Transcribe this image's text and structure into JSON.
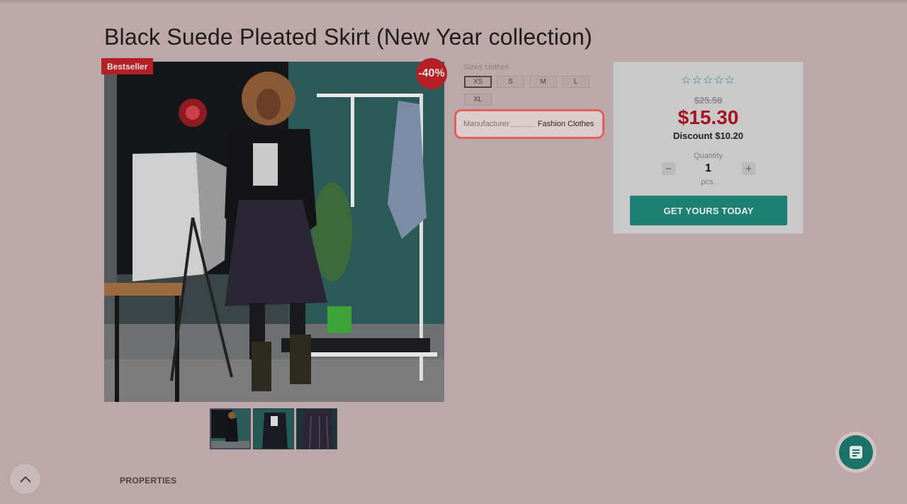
{
  "product": {
    "title": "Black Suede Pleated Skirt (New Year collection)",
    "badge_bestseller": "Bestseller",
    "badge_discount": "-40%"
  },
  "sizes": {
    "label": "Sizes clothes",
    "options": [
      "XS",
      "S",
      "M",
      "L",
      "XL"
    ],
    "selected": "XS"
  },
  "manufacturer": {
    "label": "Manufacturer",
    "value": "Fashion Clothes"
  },
  "pricing": {
    "old_price": "$25.50",
    "new_price": "$15.30",
    "discount": "Discount $10.20",
    "rating_stars": 0,
    "rating_max": 5
  },
  "quantity": {
    "label": "Quantity",
    "value": "1",
    "unit": "pcs.",
    "minus": "−",
    "plus": "+"
  },
  "cta": {
    "label": "GET YOURS TODAY"
  },
  "sections": {
    "properties": "PROPERTIES"
  },
  "icons": {
    "scroll_top": "chevron-up-icon",
    "chat": "chat-icon",
    "star": "star-outline-icon"
  },
  "colors": {
    "accent": "#1e7f73",
    "price": "#a5121e",
    "badge": "#b42025",
    "highlight": "#e0605a"
  }
}
